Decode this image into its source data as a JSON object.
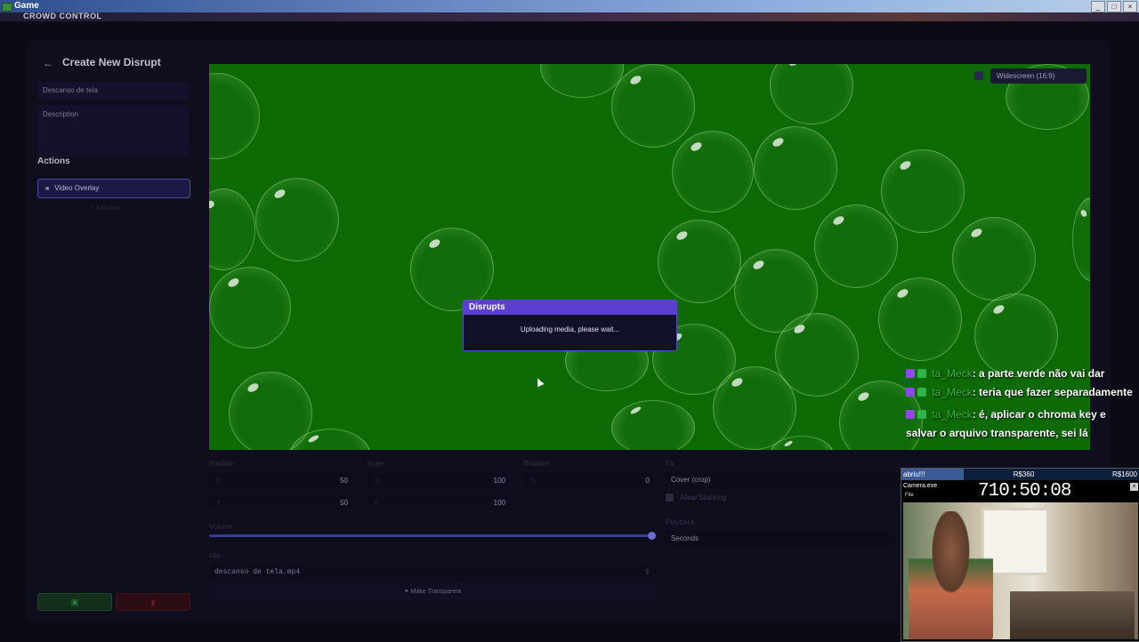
{
  "window": {
    "title": "Game",
    "controls": [
      "_",
      "□",
      "×"
    ]
  },
  "brand": "CROWD CONTROL",
  "editor": {
    "page_title": "Create New Disrupt",
    "name_value": "Descanso de tela",
    "description_placeholder": "Description",
    "actions_label": "Actions",
    "action_item": "Video Overlay",
    "add_item": "+ Add Item",
    "save_icon": "save-icon",
    "delete_icon": "trash-icon"
  },
  "preview": {
    "aspect_label": "Widescreen (16:9)",
    "background_color": "#0d6a05"
  },
  "modal": {
    "title": "Disrupts",
    "message": "Uploading media, please wait..."
  },
  "controls": {
    "position_label": "Position",
    "position_x": "50",
    "position_y": "50",
    "scale_label": "Scale",
    "scale_x": "100",
    "scale_y": "100",
    "rotation_label": "Rotation",
    "rotation_value": "0",
    "axis_x": "X",
    "axis_y": "Y",
    "fit_label": "Fit",
    "fit_value": "Cover (crop)",
    "allow_stacking": "Allow Stacking",
    "playback_label": "Playback",
    "playback_value": "Seconds",
    "volume_label": "Volume",
    "volume_level": 1.0,
    "file_label": "File",
    "file_value": "descanso de tela.mp4",
    "make_transparent": "Make Transparent"
  },
  "chat": [
    {
      "user": "ta_Meck",
      "message": ": a parte verde não vai dar"
    },
    {
      "user": "ta_Meck",
      "message": ": teria que fazer separadamente"
    },
    {
      "user": "ta_Meck",
      "message": ": é, aplicar o chroma key e salvar o arquivo transparente, sei lá"
    }
  ],
  "webcam": {
    "tab1": "abriu!!!",
    "tab2": "R$360",
    "tab3": "R$1600",
    "window_title": "Camera.exe",
    "sub": "File",
    "timer": "710:50:08"
  }
}
